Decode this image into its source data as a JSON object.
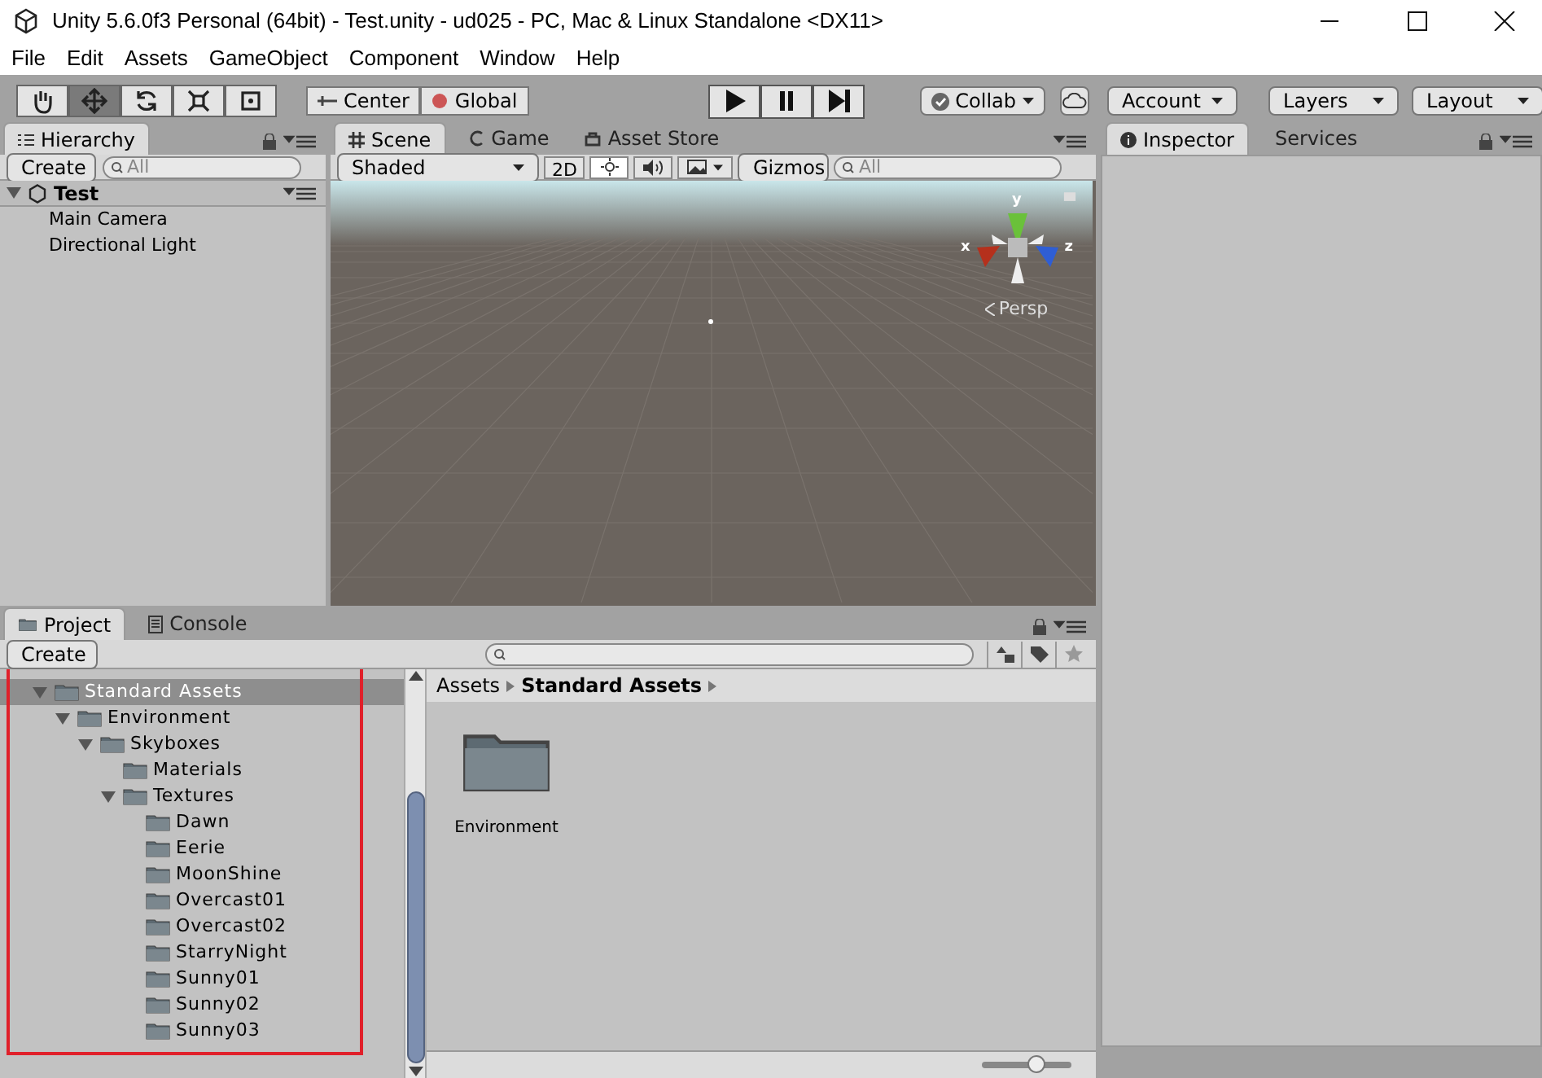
{
  "window": {
    "title": "Unity 5.6.0f3 Personal (64bit) - Test.unity - ud025 - PC, Mac & Linux Standalone <DX11>"
  },
  "menu": [
    "File",
    "Edit",
    "Assets",
    "GameObject",
    "Component",
    "Window",
    "Help"
  ],
  "tools": [
    {
      "kind": "hand",
      "selected": false
    },
    {
      "kind": "move",
      "selected": true
    },
    {
      "kind": "rotate",
      "selected": false
    },
    {
      "kind": "scale",
      "selected": false
    },
    {
      "kind": "rect",
      "selected": false
    }
  ],
  "pivot": [
    "Center",
    "Global"
  ],
  "play": [
    {
      "kind": "play"
    },
    {
      "kind": "pause"
    },
    {
      "kind": "step"
    }
  ],
  "right_toolbar": {
    "collab": "Collab",
    "account": "Account",
    "layers": "Layers",
    "layout": "Layout"
  },
  "hierarchy": {
    "tabs": [
      {
        "label": "Hierarchy",
        "selected": true
      }
    ],
    "create": "Create",
    "search_placeholder": "All",
    "scene": "Test",
    "objects": [
      "Main Camera",
      "Directional Light"
    ]
  },
  "scene_view": {
    "tabs": [
      {
        "label": "Scene",
        "selected": true
      },
      {
        "label": "Game",
        "selected": false
      },
      {
        "label": "Asset Store",
        "selected": false
      }
    ],
    "shading": "Shaded",
    "mode_2d": "2D",
    "toggles": [
      {
        "kind": "lighting",
        "on": true
      },
      {
        "kind": "audio",
        "on": false
      },
      {
        "kind": "effects",
        "on": false
      }
    ],
    "gizmos": "Gizmos",
    "search_placeholder": "All",
    "axes": [
      "y",
      "x",
      "z"
    ],
    "projection": "Persp"
  },
  "inspector": {
    "tabs": [
      {
        "label": "Inspector",
        "selected": true
      },
      {
        "label": "Services",
        "selected": false
      }
    ]
  },
  "project": {
    "tabs": [
      {
        "label": "Project",
        "selected": true
      },
      {
        "label": "Console",
        "selected": false
      }
    ],
    "create": "Create",
    "tree": [
      {
        "label": "Standard Assets",
        "selected": true,
        "expanded": true,
        "children": [
          {
            "label": "Environment",
            "selected": false,
            "expanded": true,
            "children": [
              {
                "label": "Skyboxes",
                "selected": false,
                "expanded": true,
                "children": [
                  {
                    "label": "Materials",
                    "selected": false
                  },
                  {
                    "label": "Textures",
                    "selected": false,
                    "expanded": true,
                    "children": [
                      {
                        "label": "Dawn",
                        "selected": false
                      },
                      {
                        "label": "Eerie",
                        "selected": false
                      },
                      {
                        "label": "MoonShine",
                        "selected": false
                      },
                      {
                        "label": "Overcast01",
                        "selected": false
                      },
                      {
                        "label": "Overcast02",
                        "selected": false
                      },
                      {
                        "label": "StarryNight",
                        "selected": false
                      },
                      {
                        "label": "Sunny01",
                        "selected": false
                      },
                      {
                        "label": "Sunny02",
                        "selected": false
                      },
                      {
                        "label": "Sunny03",
                        "selected": false
                      }
                    ]
                  }
                ]
              }
            ]
          }
        ]
      }
    ],
    "breadcrumb": [
      "Assets",
      "Standard Assets"
    ],
    "items": [
      "Environment"
    ],
    "zoom_slider": {
      "level": 0.6
    }
  }
}
